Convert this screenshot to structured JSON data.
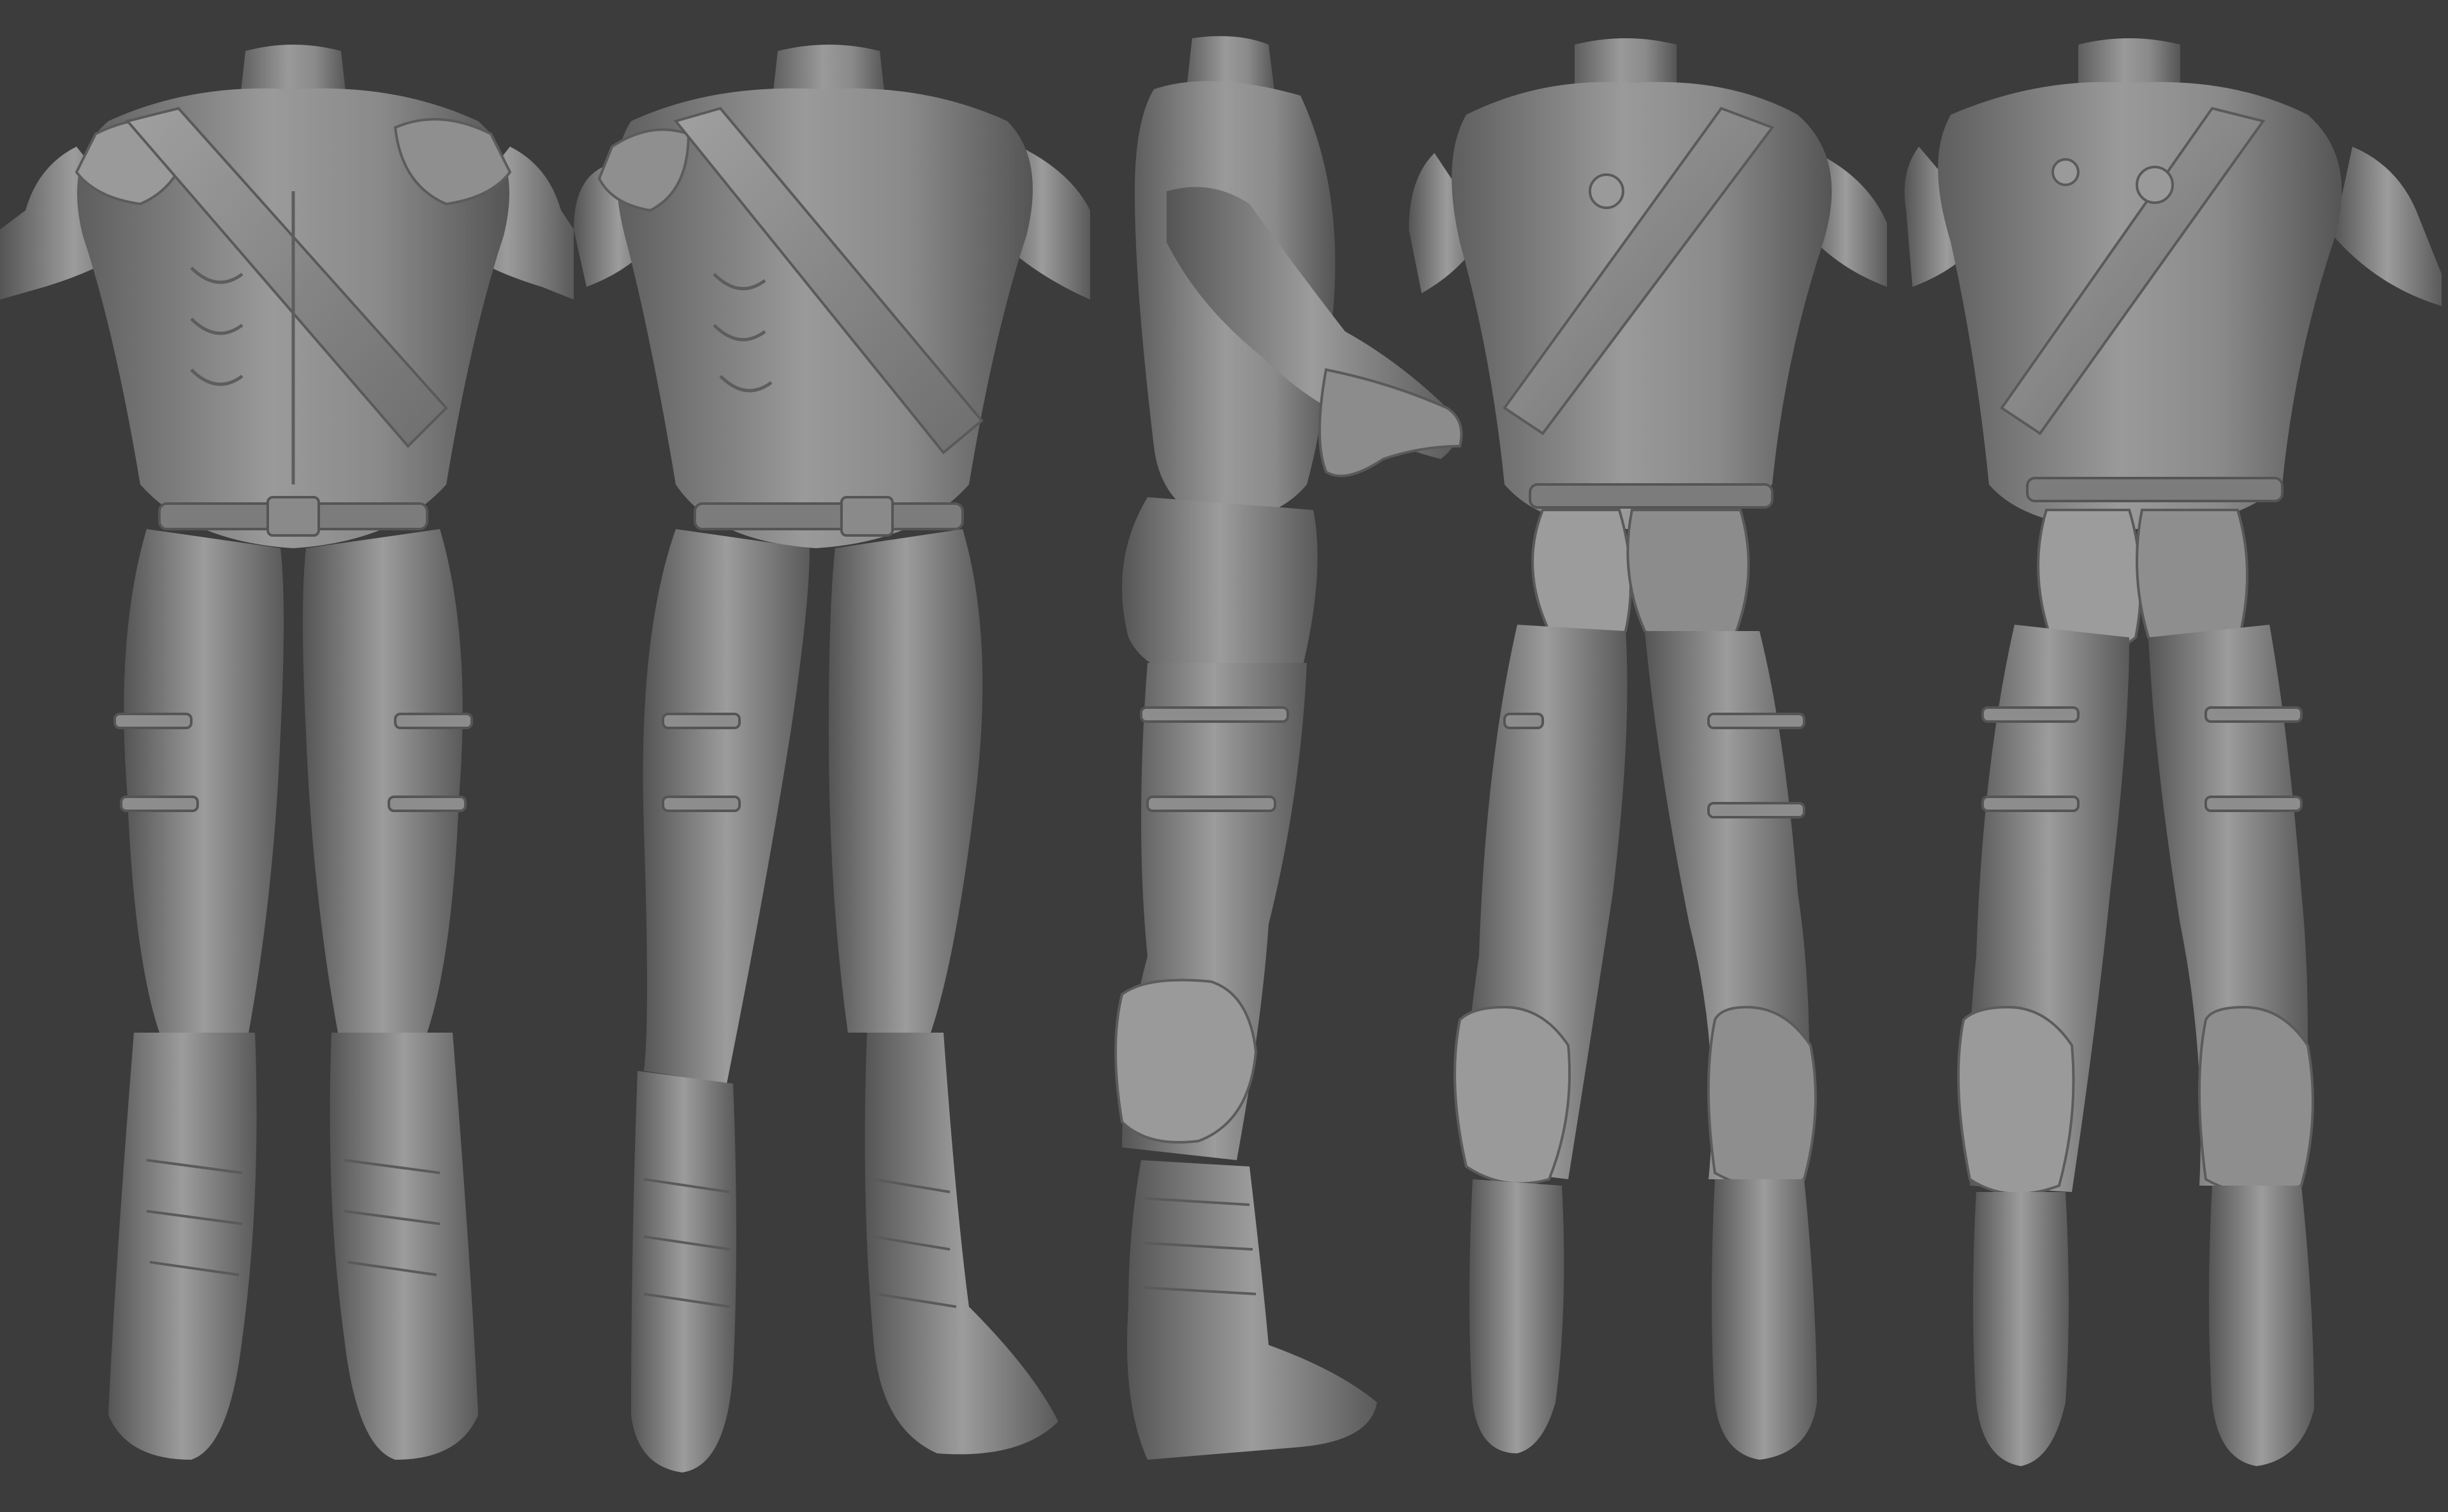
{
  "scene": {
    "background_color": "#3c3c3c",
    "material_color": "#8a8a8a",
    "shadow_color": "#5a5a5a",
    "highlight_color": "#b8b8b8",
    "views": [
      {
        "view": "front",
        "name": "front-view"
      },
      {
        "view": "three-quarter-front",
        "name": "three-quarter-front-view"
      },
      {
        "view": "side",
        "name": "side-view"
      },
      {
        "view": "three-quarter-back",
        "name": "three-quarter-back-view"
      },
      {
        "view": "back",
        "name": "back-view"
      }
    ]
  }
}
